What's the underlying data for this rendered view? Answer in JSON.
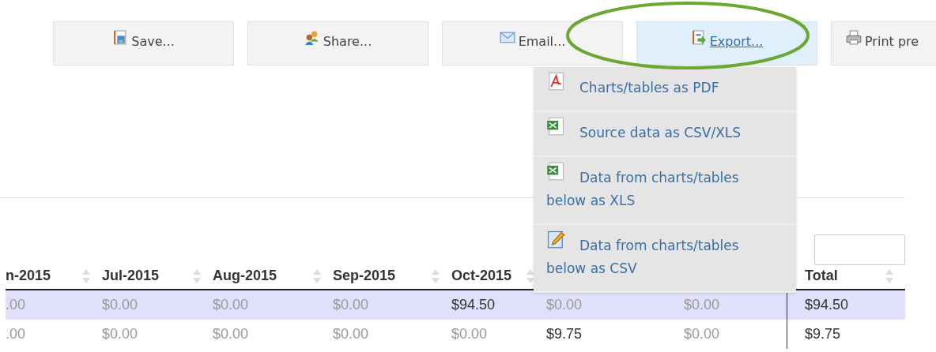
{
  "toolbar": [
    {
      "label": "Save...",
      "active": false
    },
    {
      "label": "Share...",
      "active": false
    },
    {
      "label": "Email...",
      "active": false
    },
    {
      "label": "Export...",
      "active": true
    },
    {
      "label": "Print pre",
      "active": false
    }
  ],
  "export_menu": [
    {
      "label": "Charts/tables as PDF"
    },
    {
      "label": "Source data as CSV/XLS"
    },
    {
      "label": "Data from charts/tables below as XLS"
    },
    {
      "label": "Data from charts/tables below as CSV"
    }
  ],
  "annotation": {
    "kind": "ellipse",
    "color": "#6aa832"
  },
  "table": {
    "columns": [
      {
        "label": "n-2015"
      },
      {
        "label": "Jul-2015"
      },
      {
        "label": "Aug-2015"
      },
      {
        "label": "Sep-2015"
      },
      {
        "label": "Oct-2015"
      },
      null,
      null,
      {
        "label": "Total"
      }
    ],
    "rows": [
      {
        "selected": true,
        "cells": [
          ".00",
          "$0.00",
          "$0.00",
          "$0.00",
          "$94.50",
          "$0.00",
          "$0.00",
          "$94.50"
        ]
      },
      {
        "selected": false,
        "cells": [
          ".00",
          "$0.00",
          "$0.00",
          "$0.00",
          "$0.00",
          "$9.75",
          "$0.00",
          "$9.75"
        ]
      }
    ]
  }
}
